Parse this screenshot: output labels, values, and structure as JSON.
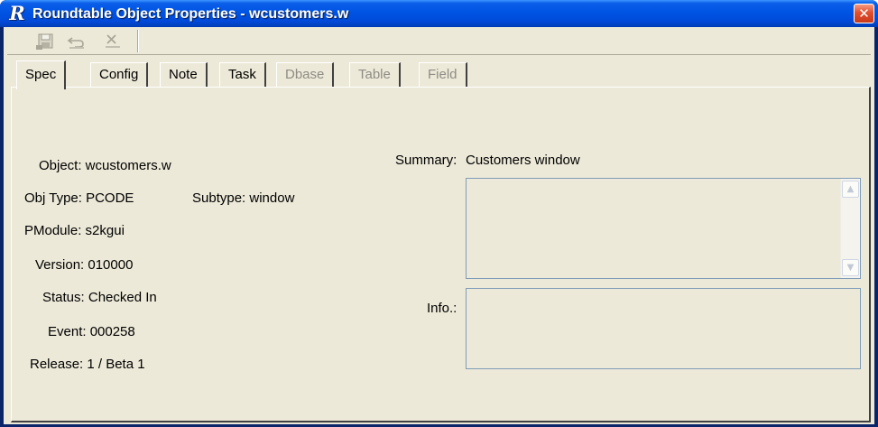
{
  "window": {
    "title": "Roundtable Object Properties - wcustomers.w",
    "app_icon_glyph": "R",
    "close_glyph": "✕"
  },
  "toolbar": {
    "buttons": [
      {
        "name": "save-icon",
        "enabled": false
      },
      {
        "name": "undo-icon",
        "enabled": false
      },
      {
        "name": "delete-icon",
        "enabled": false
      }
    ]
  },
  "tabs": [
    {
      "label": "Spec",
      "active": true,
      "enabled": true
    },
    {
      "label": "Config",
      "active": false,
      "enabled": true
    },
    {
      "label": "Note",
      "active": false,
      "enabled": true
    },
    {
      "label": "Task",
      "active": false,
      "enabled": true
    },
    {
      "label": "Dbase",
      "active": false,
      "enabled": false
    },
    {
      "label": "Table",
      "active": false,
      "enabled": false
    },
    {
      "label": "Field",
      "active": false,
      "enabled": false
    }
  ],
  "spec": {
    "object": "Object: wcustomers.w",
    "obj_type": "Obj Type: PCODE",
    "subtype": "Subtype: window",
    "pmodule": "PModule: s2kgui",
    "version": "Version: 010000",
    "status": "Status: Checked In",
    "event": "Event: 000258",
    "release": "Release: 1 / Beta 1",
    "summary_label": "Summary:",
    "summary_value": "Customers window",
    "summary_text": "",
    "info_label": "Info.:",
    "info_text": ""
  },
  "colors": {
    "titlebar": "#0054e3",
    "face": "#ece9d8",
    "close": "#e0502f",
    "disabled_text": "#8e8c84"
  }
}
